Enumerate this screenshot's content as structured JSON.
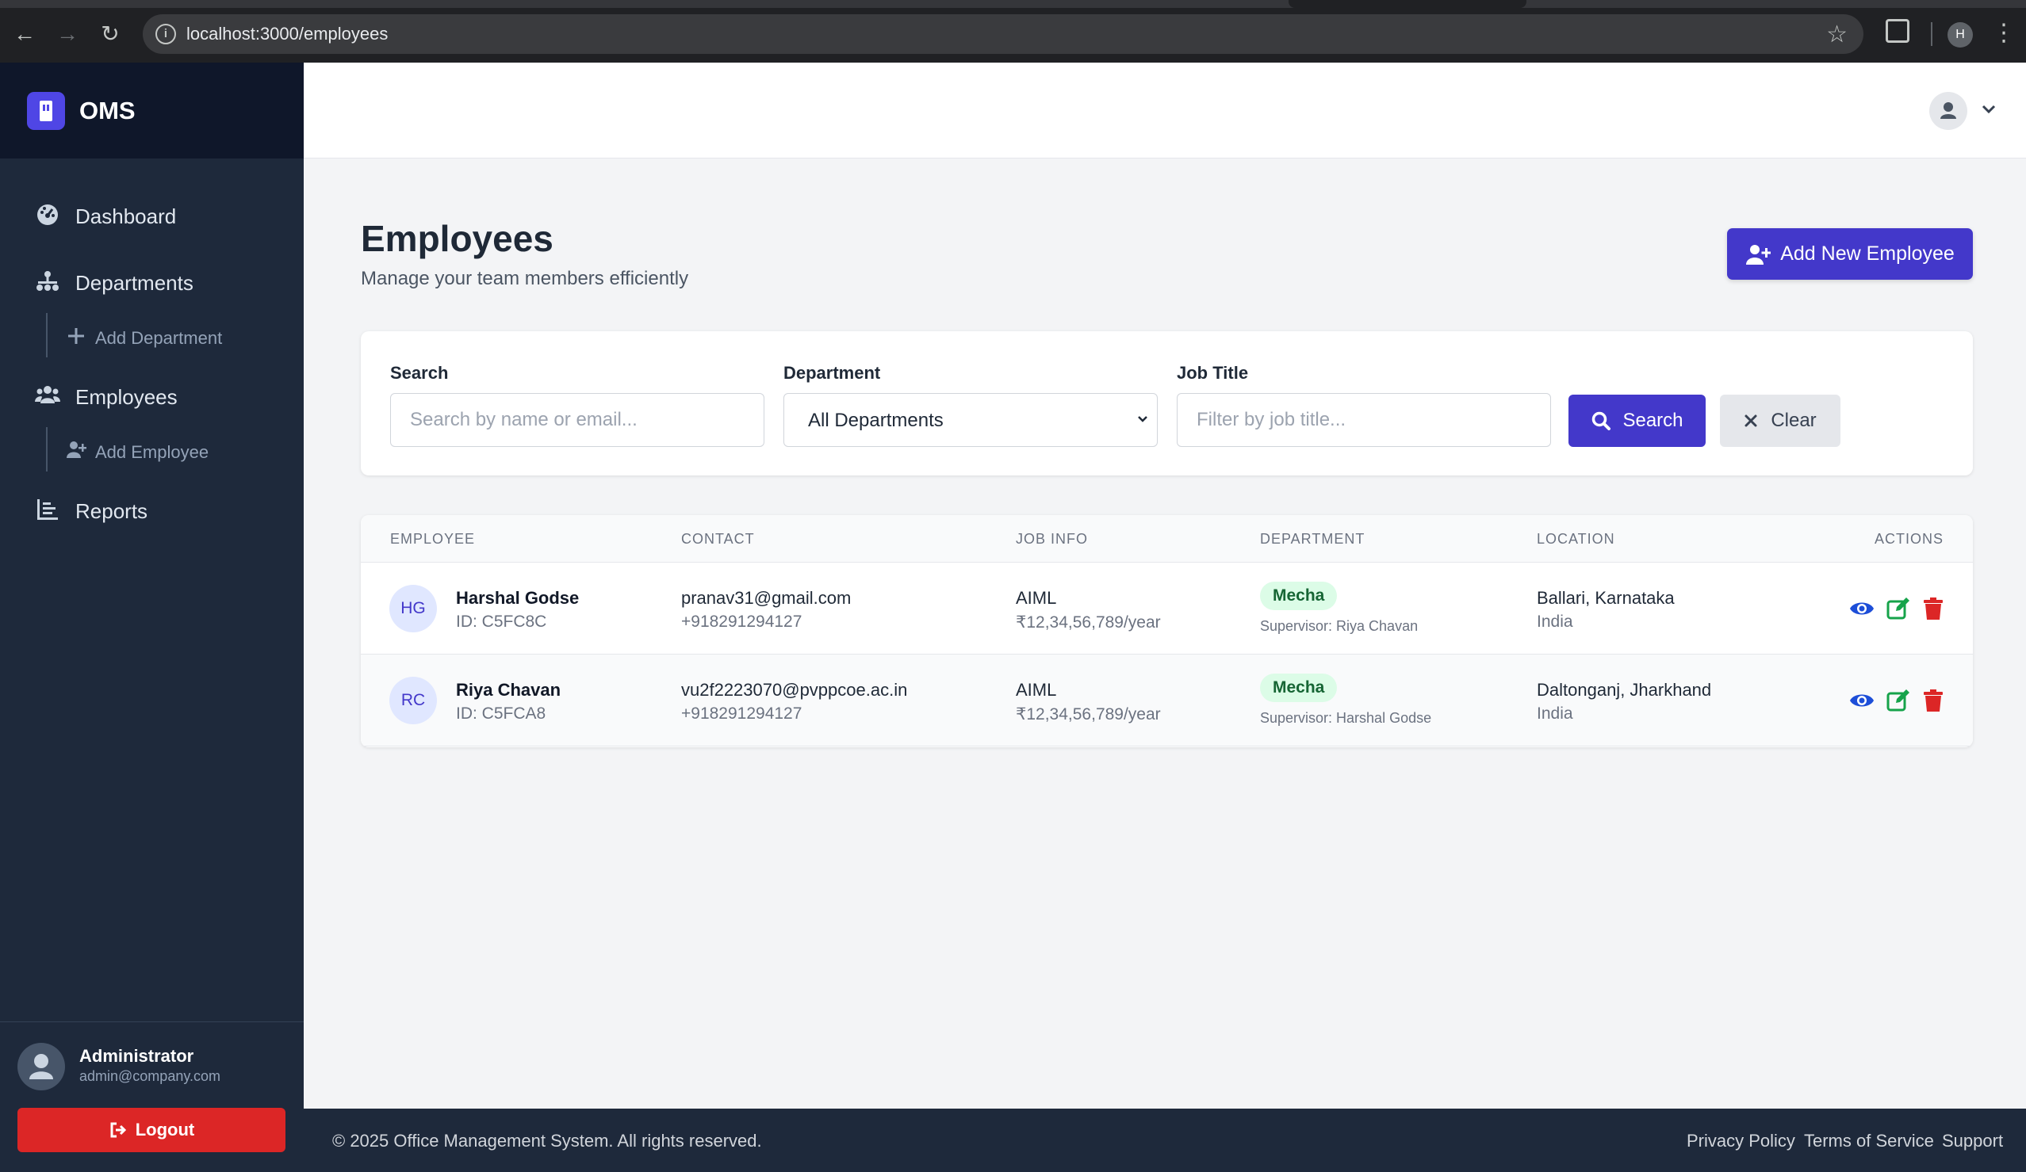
{
  "browser": {
    "url": "localhost:3000/employees",
    "profile_initial": "H"
  },
  "sidebar": {
    "brand": "OMS",
    "items": [
      {
        "label": "Dashboard",
        "icon": "dashboard-gauge-icon"
      },
      {
        "label": "Departments",
        "icon": "sitemap-icon"
      },
      {
        "label": "Add Department",
        "icon": "plus-icon",
        "sub": true
      },
      {
        "label": "Employees",
        "icon": "users-icon"
      },
      {
        "label": "Add Employee",
        "icon": "user-plus-icon",
        "sub": true
      },
      {
        "label": "Reports",
        "icon": "chart-bar-icon"
      }
    ],
    "user": {
      "name": "Administrator",
      "email": "admin@company.com"
    },
    "logout_label": "Logout"
  },
  "page": {
    "title": "Employees",
    "subtitle": "Manage your team members efficiently",
    "add_button": "Add New Employee"
  },
  "filters": {
    "search_label": "Search",
    "search_placeholder": "Search by name or email...",
    "department_label": "Department",
    "department_value": "All Departments",
    "job_label": "Job Title",
    "job_placeholder": "Filter by job title...",
    "search_button": "Search",
    "clear_button": "Clear"
  },
  "table": {
    "headers": [
      "EMPLOYEE",
      "CONTACT",
      "JOB INFO",
      "DEPARTMENT",
      "LOCATION",
      "ACTIONS"
    ],
    "rows": [
      {
        "initials": "HG",
        "name": "Harshal Godse",
        "id": "ID: C5FC8C",
        "email": "pranav31@gmail.com",
        "phone": "+918291294127",
        "job": "AIML",
        "salary": "₹12,34,56,789/year",
        "department": "Mecha",
        "supervisor": "Supervisor: Riya Chavan",
        "city": "Ballari, Karnataka",
        "country": "India"
      },
      {
        "initials": "RC",
        "name": "Riya Chavan",
        "id": "ID: C5FCA8",
        "email": "vu2f2223070@pvppcoe.ac.in",
        "phone": "+918291294127",
        "job": "AIML",
        "salary": "₹12,34,56,789/year",
        "department": "Mecha",
        "supervisor": "Supervisor: Harshal Godse",
        "city": "Daltonganj, Jharkhand",
        "country": "India"
      }
    ]
  },
  "footer": {
    "copyright": "© 2025 Office Management System. All rights reserved.",
    "links": [
      "Privacy Policy",
      "Terms of Service",
      "Support"
    ]
  },
  "colors": {
    "primary": "#4338ca",
    "sidebar": "#1e293b",
    "danger": "#dc2626",
    "view": "#1d4ed8",
    "edit": "#16a34a",
    "badge_bg": "#dcfce7"
  }
}
